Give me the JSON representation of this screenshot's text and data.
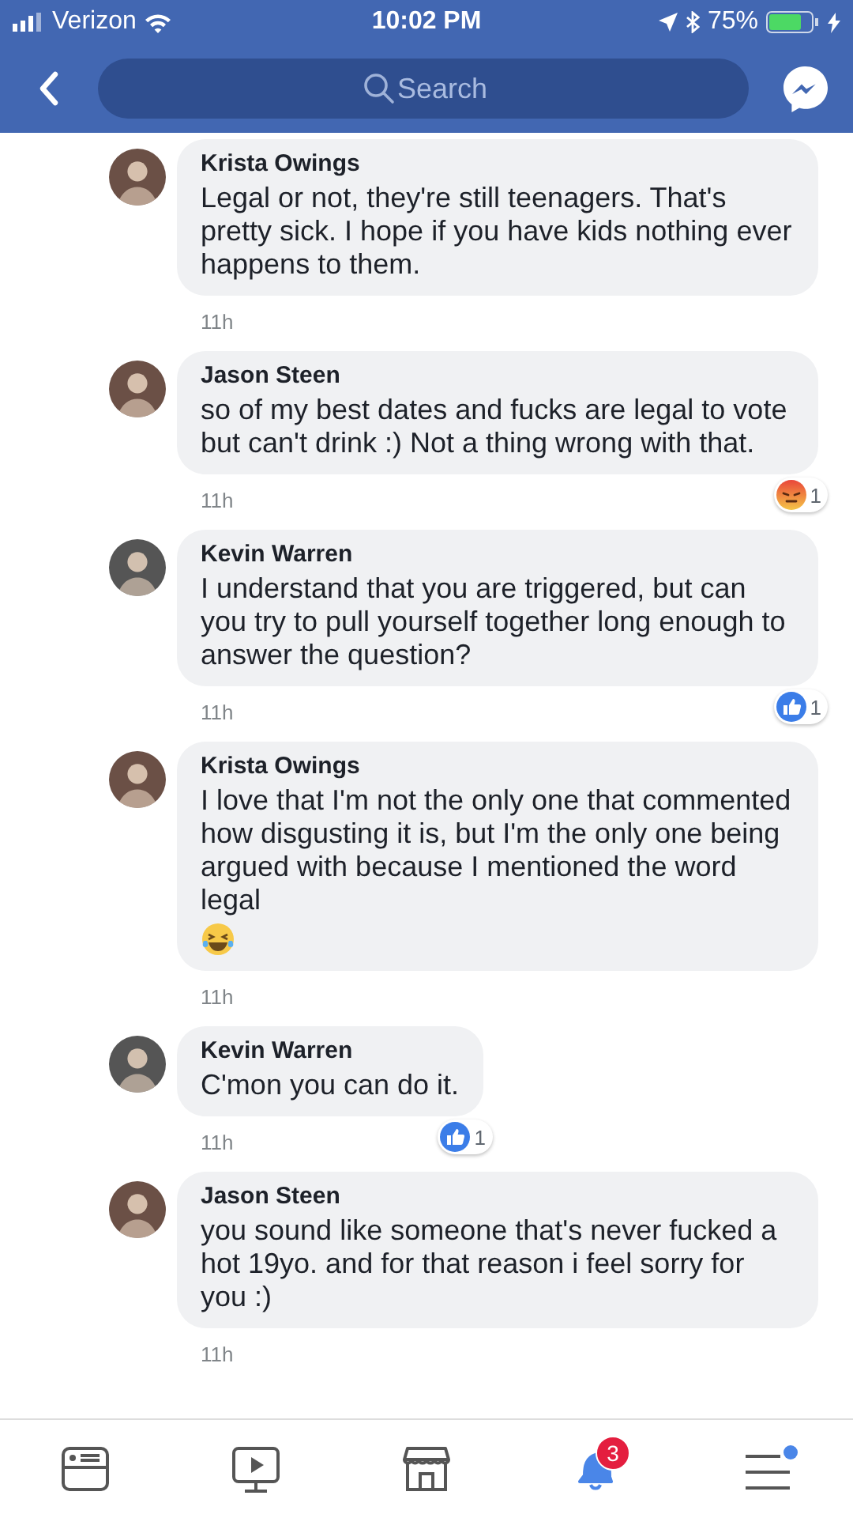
{
  "status_bar": {
    "carrier": "Verizon",
    "time": "10:02 PM",
    "battery": "75%"
  },
  "header": {
    "search_placeholder": "Search"
  },
  "comments": [
    {
      "author": "Krista Owings",
      "text": "Legal or not, they're still teenagers. That's pretty sick. I hope if you have kids nothing ever happens to them.",
      "time": "11h"
    },
    {
      "author": "Jason Steen",
      "text": "so of my best dates and fucks are legal to vote but can't drink :) Not a thing wrong with that.",
      "time": "11h",
      "reaction": {
        "kind": "angry",
        "count": "1"
      }
    },
    {
      "author": "Kevin Warren",
      "text": "I understand that you are triggered, but can you try to pull yourself together long enough to answer the question?",
      "time": "11h",
      "reaction": {
        "kind": "like",
        "count": "1"
      }
    },
    {
      "author": "Krista Owings",
      "text": "I love that I'm not the only one that commented how disgusting it is, but I'm the only one being argued with because I mentioned the word legal",
      "emoji": {
        "kind": "laughing"
      },
      "time": "11h"
    },
    {
      "author": "Kevin Warren",
      "text": "C'mon you can do it.",
      "time": "11h",
      "reaction": {
        "kind": "like",
        "count": "1"
      }
    },
    {
      "author": "Jason Steen",
      "text": "you sound like someone that's never fucked a hot 19yo. and for that reason i feel sorry for you :)",
      "time": "11h"
    }
  ],
  "tab_bar": [
    {
      "kind": "news",
      "selected": false
    },
    {
      "kind": "video",
      "selected": false
    },
    {
      "kind": "market",
      "selected": false
    },
    {
      "kind": "bell",
      "selected": true,
      "badge": "3"
    },
    {
      "kind": "menu",
      "selected": false,
      "dot": true
    }
  ]
}
